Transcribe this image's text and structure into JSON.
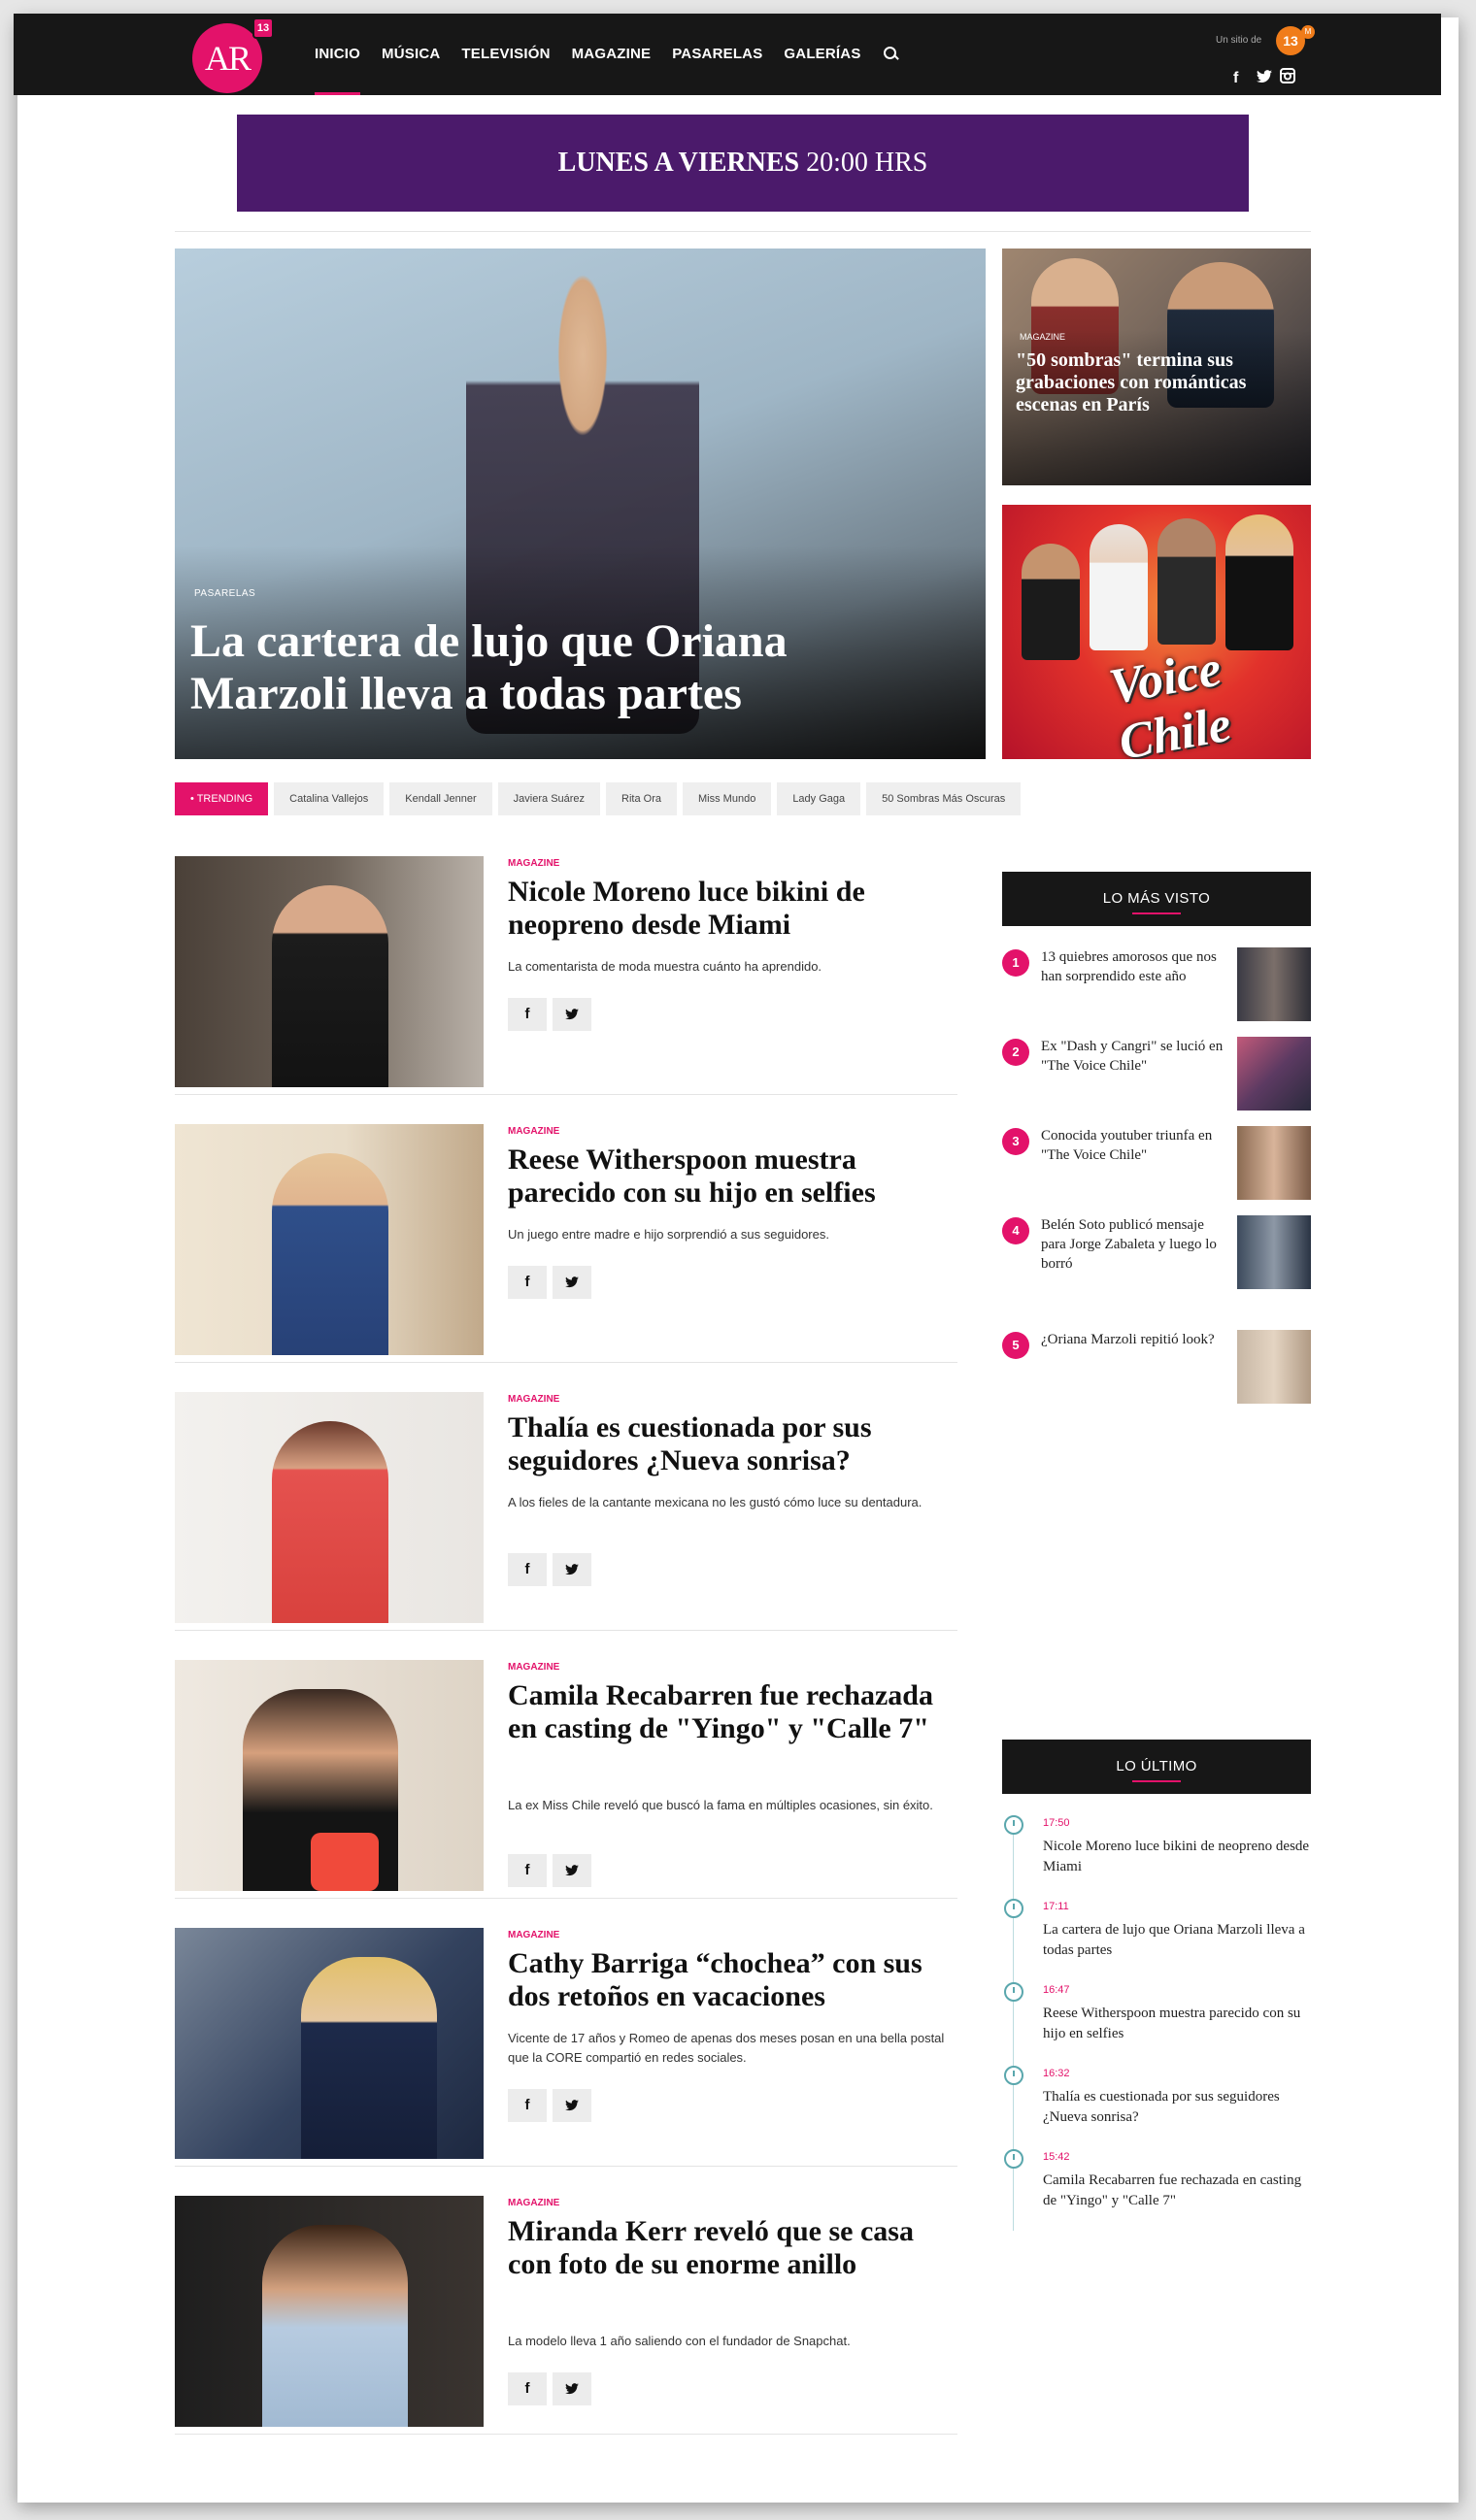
{
  "header": {
    "logo_text": "AR",
    "logo_badge": "13",
    "nav": [
      "INICIO",
      "MÚSICA",
      "TELEVISIÓN",
      "MAGAZINE",
      "PASARELAS",
      "GALERÍAS"
    ],
    "site_of": "Un sitio de",
    "site_badge": "13",
    "site_badge_small": "M",
    "social": {
      "facebook": "f",
      "twitter": "t",
      "instagram": "i"
    }
  },
  "banner": {
    "bold": "LUNES A VIERNES",
    "rest": " 20:00 HRS"
  },
  "hero": {
    "kicker": "PASARELAS",
    "title": "La cartera de lujo que Oriana Marzoli lleva a todas partes"
  },
  "side_story": {
    "kicker": "MAGAZINE",
    "title": "\"50 sombras\" termina sus grabaciones con románticas escenas en París"
  },
  "promo": {
    "logo_text": "Voice Chile"
  },
  "trending": {
    "label": "• TRENDING",
    "tags": [
      "Catalina Vallejos",
      "Kendall Jenner",
      "Javiera Suárez",
      "Rita Ora",
      "Miss Mundo",
      "Lady Gaga",
      "50 Sombras Más Oscuras"
    ]
  },
  "articles": [
    {
      "kicker": "MAGAZINE",
      "title": "Nicole Moreno luce bikini de neopreno desde Miami",
      "summary": "La comentarista de moda muestra cuánto ha aprendido."
    },
    {
      "kicker": "MAGAZINE",
      "title": "Reese Witherspoon muestra parecido con su hijo en selfies",
      "summary": "Un juego entre madre e hijo sorprendió a sus seguidores."
    },
    {
      "kicker": "MAGAZINE",
      "title": "Thalía es cuestionada por sus seguidores ¿Nueva sonrisa?",
      "summary": "A los fieles de la cantante mexicana no les gustó cómo luce su dentadura."
    },
    {
      "kicker": "MAGAZINE",
      "title": "Camila Recabarren fue rechazada en casting de \"Yingo\" y \"Calle 7\"",
      "summary": "La ex Miss Chile reveló que buscó la fama en múltiples ocasiones, sin éxito."
    },
    {
      "kicker": "MAGAZINE",
      "title": "Cathy Barriga “chochea” con sus dos retoños en vacaciones",
      "summary": "Vicente de 17 años y Romeo de apenas dos meses posan en una bella postal que la CORE compartió en redes sociales."
    },
    {
      "kicker": "MAGAZINE",
      "title": "Miranda Kerr reveló que se casa con foto de su enorme anillo",
      "summary": "La modelo lleva 1 año saliendo con el fundador de Snapchat."
    }
  ],
  "share": {
    "facebook": "f",
    "twitter": "t"
  },
  "most_viewed": {
    "heading": "LO MÁS VISTO",
    "items": [
      {
        "num": "1",
        "title": "13 quiebres amorosos que nos han sorprendido este año"
      },
      {
        "num": "2",
        "title": "Ex \"Dash y Cangri\" se lució en \"The Voice Chile\""
      },
      {
        "num": "3",
        "title": "Conocida youtuber triunfa en \"The Voice Chile\""
      },
      {
        "num": "4",
        "title": "Belén Soto publicó mensaje para Jorge Zabaleta y luego lo borró"
      },
      {
        "num": "5",
        "title": "¿Oriana Marzoli repitió look?"
      }
    ]
  },
  "latest": {
    "heading": "LO ÚLTIMO",
    "items": [
      {
        "time": "17:50",
        "title": "Nicole Moreno luce bikini de neopreno desde Miami"
      },
      {
        "time": "17:11",
        "title": "La cartera de lujo que Oriana Marzoli lleva a todas partes"
      },
      {
        "time": "16:47",
        "title": "Reese Witherspoon muestra parecido con su hijo en selfies"
      },
      {
        "time": "16:32",
        "title": "Thalía es cuestionada por sus seguidores ¿Nueva sonrisa?"
      },
      {
        "time": "15:42",
        "title": "Camila Recabarren fue rechazada en casting de \"Yingo\" y \"Calle 7\""
      }
    ]
  },
  "colors": {
    "accent": "#e3126a",
    "header_bg": "#171717",
    "banner_bg": "#4b1a6b",
    "timeline": "#5aa7ad"
  }
}
